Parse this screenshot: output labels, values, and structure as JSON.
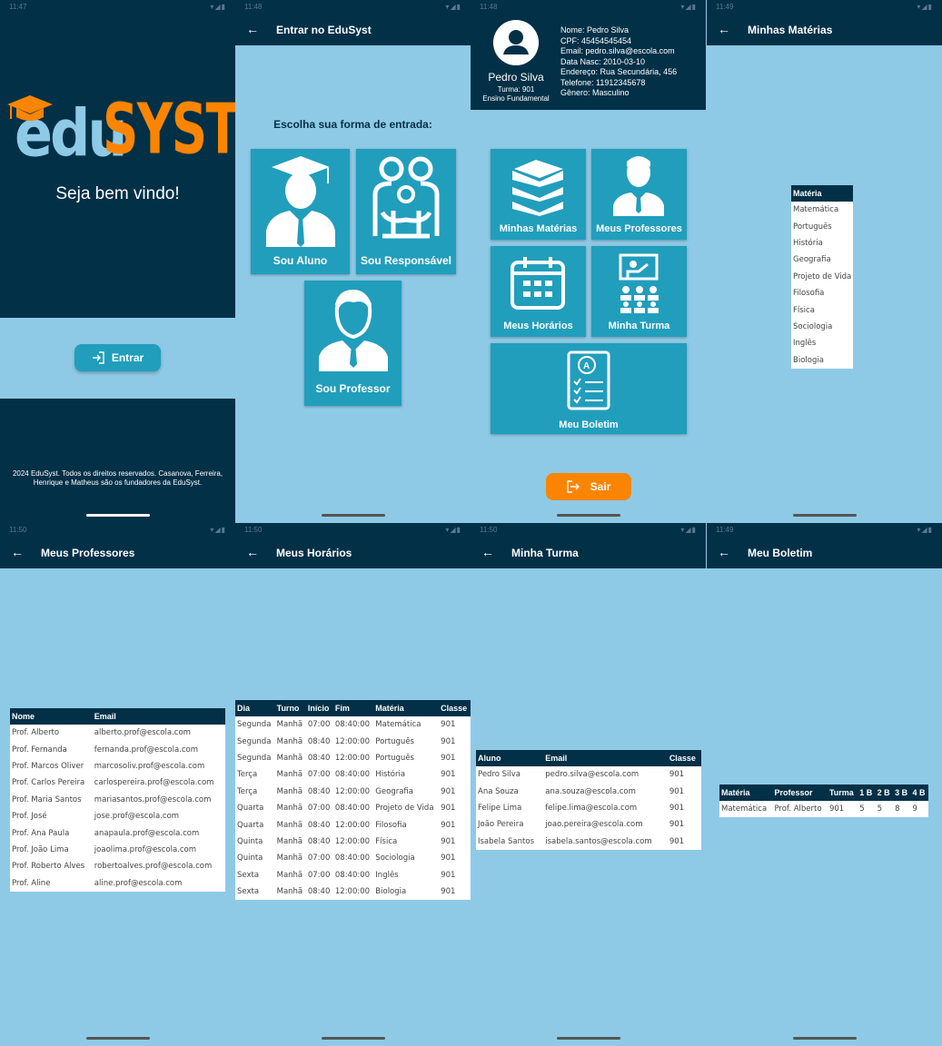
{
  "status": {
    "time_1": "11:47",
    "time_2": "11:48",
    "time_3": "11:48",
    "time_4": "11:49",
    "time_5": "11:50",
    "time_6": "11:50",
    "time_7": "11:50",
    "time_8": "11:49"
  },
  "home": {
    "logo_edu": "edu",
    "logo_syst": "SYST",
    "welcome": "Seja bem vindo!",
    "enter_label": "Entrar",
    "footer": "2024 EduSyst. Todos os direitos reservados. Casanova, Ferreira, Henrique e Matheus são os fundadores da EduSyst."
  },
  "login": {
    "title": "Entrar no EduSyst",
    "prompt": "Escolha sua forma de entrada:",
    "options": [
      "Sou Aluno",
      "Sou Responsável",
      "Sou Professor"
    ]
  },
  "dashboard": {
    "name": "Pedro Silva",
    "turma": "Turma: 901",
    "nivel": "Ensino Fundamental",
    "info": [
      "Nome: Pedro Silva",
      "CPF: 45454545454",
      "Email: pedro.silva@escola.com",
      "Data Nasc: 2010-03-10",
      "Endereço: Rua Secundária, 456",
      "Telefone: 11912345678",
      "Gênero: Masculino"
    ],
    "tiles": [
      "Minhas Matérias",
      "Meus Professores",
      "Meus Horários",
      "Minha Turma",
      "Meu Boletim"
    ],
    "logout_label": "Sair"
  },
  "materias": {
    "title": "Minhas Matérias",
    "header": "Matéria",
    "items": [
      "Matemática",
      "Português",
      "História",
      "Geografia",
      "Projeto de Vida",
      "Filosofia",
      "Física",
      "Sociologia",
      "Inglês",
      "Biologia"
    ]
  },
  "professores": {
    "title": "Meus Professores",
    "headers": [
      "Nome",
      "Email"
    ],
    "rows": [
      [
        "Prof. Alberto",
        "alberto.prof@escola.com"
      ],
      [
        "Prof. Fernanda",
        "fernanda.prof@escola.com"
      ],
      [
        "Prof. Marcos Oliver",
        "marcosoliv.prof@escola.com"
      ],
      [
        "Prof. Carlos Pereira",
        "carlospereira.prof@escola.com"
      ],
      [
        "Prof. Maria Santos",
        "mariasantos.prof@escola.com"
      ],
      [
        "Prof. José",
        "jose.prof@escola.com"
      ],
      [
        "Prof. Ana Paula",
        "anapaula.prof@escola.com"
      ],
      [
        "Prof. João Lima",
        "joaolima.prof@escola.com"
      ],
      [
        "Prof. Roberto Alves",
        "robertoalves.prof@escola.com"
      ],
      [
        "Prof. Aline",
        "aline.prof@escola.com"
      ]
    ]
  },
  "horarios": {
    "title": "Meus Horários",
    "headers": [
      "Dia",
      "Turno",
      "Início",
      "Fim",
      "Matéria",
      "Classe"
    ],
    "rows": [
      [
        "Segunda",
        "Manhã",
        "07:00",
        "08:40:00",
        "Matemática",
        "901"
      ],
      [
        "Segunda",
        "Manhã",
        "08:40",
        "12:00:00",
        "Português",
        "901"
      ],
      [
        "Segunda",
        "Manhã",
        "08:40",
        "12:00:00",
        "Português",
        "901"
      ],
      [
        "Terça",
        "Manhã",
        "07:00",
        "08:40:00",
        "História",
        "901"
      ],
      [
        "Terça",
        "Manhã",
        "08:40",
        "12:00:00",
        "Geografia",
        "901"
      ],
      [
        "Quarta",
        "Manhã",
        "07:00",
        "08:40:00",
        "Projeto de Vida",
        "901"
      ],
      [
        "Quarta",
        "Manhã",
        "08:40",
        "12:00:00",
        "Filosofia",
        "901"
      ],
      [
        "Quinta",
        "Manhã",
        "08:40",
        "12:00:00",
        "Física",
        "901"
      ],
      [
        "Quinta",
        "Manhã",
        "07:00",
        "08:40:00",
        "Sociologia",
        "901"
      ],
      [
        "Sexta",
        "Manhã",
        "07:00",
        "08:40:00",
        "Inglês",
        "901"
      ],
      [
        "Sexta",
        "Manhã",
        "08:40",
        "12:00:00",
        "Biologia",
        "901"
      ]
    ]
  },
  "turma": {
    "title": "Minha Turma",
    "headers": [
      "Aluno",
      "Email",
      "Classe"
    ],
    "rows": [
      [
        "Pedro Silva",
        "pedro.silva@escola.com",
        "901"
      ],
      [
        "Ana Souza",
        "ana.souza@escola.com",
        "901"
      ],
      [
        "Felipe Lima",
        "felipe.lima@escola.com",
        "901"
      ],
      [
        "João Pereira",
        "joao.pereira@escola.com",
        "901"
      ],
      [
        "Isabela Santos",
        "isabela.santos@escola.com",
        "901"
      ]
    ]
  },
  "boletim": {
    "title": "Meu Boletim",
    "headers": [
      "Matéria",
      "Professor",
      "Turma",
      "1 B",
      "2 B",
      "3 B",
      "4 B"
    ],
    "rows": [
      [
        "Matemática",
        "Prof. Alberto",
        "901",
        "5",
        "5",
        "8",
        "9"
      ]
    ]
  },
  "colors": {
    "navy": "#023047",
    "sky": "#8ecae6",
    "teal": "#219ebc",
    "orange": "#fb8500"
  }
}
